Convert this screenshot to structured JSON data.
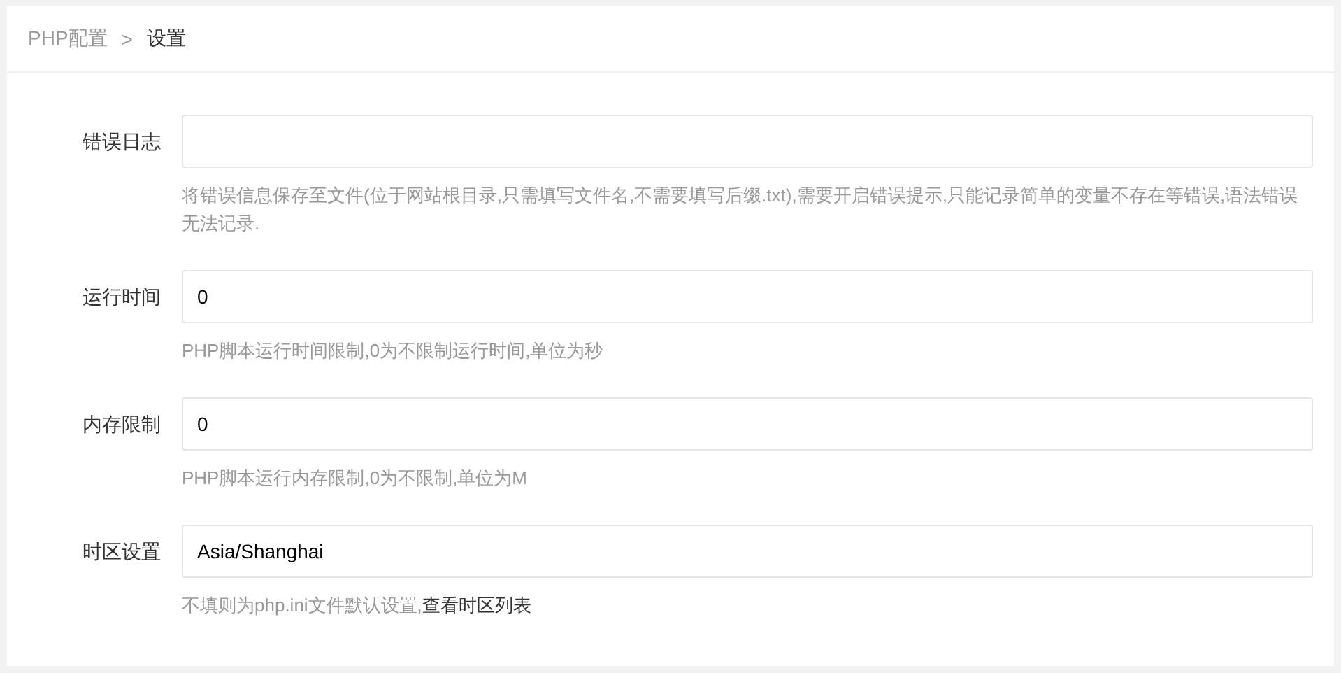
{
  "breadcrumb": {
    "items": [
      "PHP配置",
      "设置"
    ],
    "separator": ">"
  },
  "fields": [
    {
      "label": "错误日志",
      "help": "将错误信息保存至文件(位于网站根目录,只需填写文件名,不需要填写后缀.txt),需要开启错误提示,只能记录简单的变量不存在等错误,语法错误无法记录."
    },
    {
      "label": "运行时间",
      "value": "0",
      "help": "PHP脚本运行时间限制,0为不限制运行时间,单位为秒"
    },
    {
      "label": "内存限制",
      "value": "0",
      "help": "PHP脚本运行内存限制,0为不限制,单位为M"
    },
    {
      "label": "时区设置",
      "value": "Asia/Shanghai",
      "help": "不填则为php.ini文件默认设置,",
      "link": "查看时区列表"
    }
  ]
}
